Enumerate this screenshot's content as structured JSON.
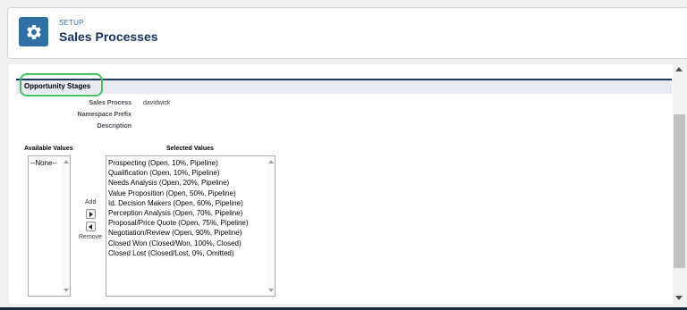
{
  "header": {
    "eyebrow": "SETUP",
    "title": "Sales Processes",
    "icon": "gear-icon",
    "icon_color": "#2e6fa6"
  },
  "section": {
    "title": "Opportunity Stages",
    "highlight_color": "#3fc25f"
  },
  "details": {
    "sales_process_label": "Sales Process",
    "sales_process_value": "davidwick",
    "namespace_prefix_label": "Namespace Prefix",
    "namespace_prefix_value": "",
    "description_label": "Description",
    "description_value": ""
  },
  "available": {
    "label": "Available Values",
    "items": [
      "--None--"
    ]
  },
  "selected": {
    "label": "Selected Values",
    "items": [
      "Prospecting (Open, 10%, Pipeline)",
      "Qualification (Open, 10%, Pipeline)",
      "Needs Analysis (Open, 20%, Pipeline)",
      "Value Proposition (Open, 50%, Pipeline)",
      "Id. Decision Makers (Open, 60%, Pipeline)",
      "Perception Analysis (Open, 70%, Pipeline)",
      "Proposal/Price Quote (Open, 75%, Pipeline)",
      "Negotiation/Review (Open, 90%, Pipeline)",
      "Closed Won (Closed/Won, 100%, Closed)",
      "Closed Lost (Closed/Lost, 0%, Omitted)"
    ]
  },
  "controls": {
    "add_label": "Add",
    "remove_label": "Remove"
  }
}
